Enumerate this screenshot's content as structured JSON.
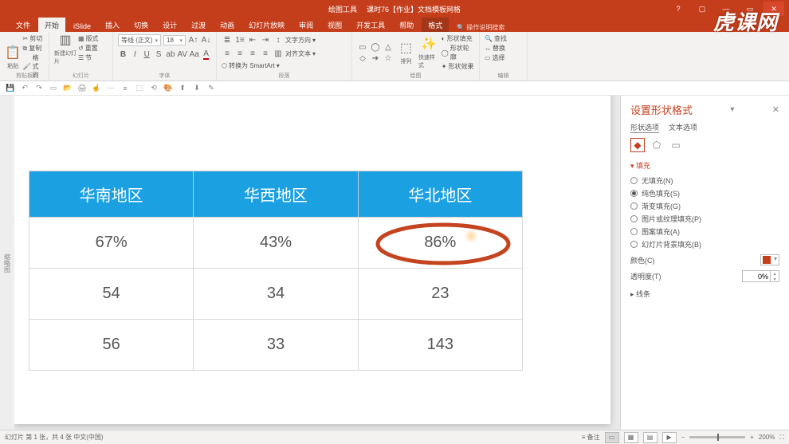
{
  "app": {
    "window_title_left": "绘图工具",
    "window_title_right": "课时76【作业】文档模板网格"
  },
  "tabs": {
    "file": "文件",
    "items": [
      "开始",
      "iSlide",
      "插入",
      "切换",
      "设计",
      "过渡",
      "动画",
      "幻灯片放映",
      "审阅",
      "视图",
      "开发工具",
      "帮助"
    ],
    "context": "格式",
    "tellme": "操作说明搜索"
  },
  "ribbon": {
    "clipboard": {
      "paste": "粘贴",
      "cut": "剪切",
      "copy": "复制",
      "painter": "格式刷",
      "label": "剪贴板"
    },
    "slides": {
      "new": "新建幻灯片",
      "layout": "版式",
      "reset": "重置",
      "section": "节",
      "label": "幻灯片"
    },
    "font": {
      "family": "等线 (正文)",
      "size": "18",
      "label": "字体"
    },
    "para": {
      "convert": "转换为 SmartArt",
      "direction": "文字方向",
      "align": "对齐文本",
      "label": "段落"
    },
    "drawing": {
      "arrange": "排列",
      "quick": "快速样式",
      "fill": "形状填充",
      "outline": "形状轮廓",
      "effects": "形状效果",
      "label": "绘图"
    },
    "editing": {
      "find": "查找",
      "replace": "替换",
      "select": "选择",
      "label": "编辑"
    }
  },
  "chart_data": {
    "type": "table",
    "headers": [
      "华南地区",
      "华西地区",
      "华北地区"
    ],
    "rows": [
      [
        "67%",
        "43%",
        "86%"
      ],
      [
        "54",
        "34",
        "23"
      ],
      [
        "56",
        "33",
        "143"
      ]
    ],
    "highlighted_cell": {
      "row": 0,
      "col": 2
    }
  },
  "sidebar": {
    "title": "设置形状格式",
    "sub_shape": "形状选项",
    "sub_text": "文本选项",
    "section_fill": "填充",
    "fill_opts": {
      "none": "无填充(N)",
      "solid": "纯色填充(S)",
      "gradient": "渐变填充(G)",
      "picture": "图片或纹理填充(P)",
      "pattern": "图案填充(A)",
      "slidebg": "幻灯片背景填充(B)"
    },
    "color_label": "颜色(C)",
    "trans_label": "透明度(T)",
    "trans_value": "0%",
    "section_line": "线条"
  },
  "status": {
    "left": "幻灯片 第 1 张，共 4 张    中文(中国)",
    "notes": "备注",
    "zoom": "200%"
  },
  "gutter": "缩略图",
  "watermark": "虎课网"
}
